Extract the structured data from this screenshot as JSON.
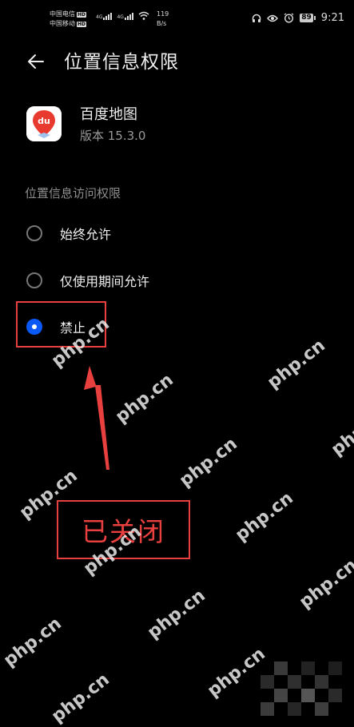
{
  "status_bar": {
    "carrier1": "中国电信",
    "carrier2": "中国移动",
    "hd_badge": "HD",
    "signal1_label": "4G",
    "signal2_label": "4G",
    "speed_value": "119",
    "speed_unit": "B/s",
    "battery": "89",
    "time": "9:21"
  },
  "header": {
    "title": "位置信息权限"
  },
  "app": {
    "name": "百度地图",
    "version": "版本 15.3.0",
    "icon_text": "du",
    "icon_color": "#e83a2f"
  },
  "section": {
    "label": "位置信息访问权限"
  },
  "options": [
    {
      "label": "始终允许",
      "selected": false
    },
    {
      "label": "仅使用期间允许",
      "selected": false
    },
    {
      "label": "禁止",
      "selected": true
    }
  ],
  "annotation": {
    "text": "已关闭",
    "color": "#e8403f"
  },
  "watermark": {
    "text": "php.cn"
  },
  "colors": {
    "accent": "#0a59f7",
    "background": "#000000"
  }
}
